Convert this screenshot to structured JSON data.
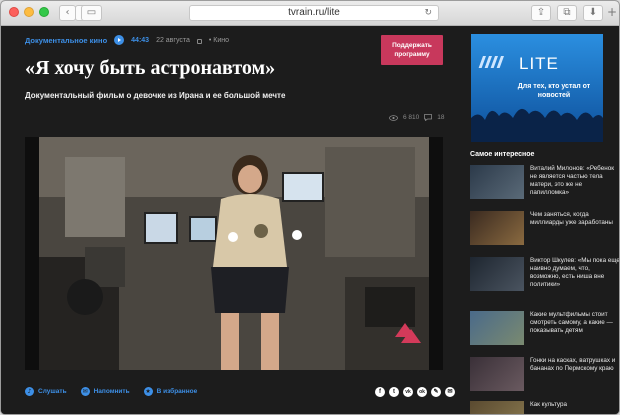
{
  "browser": {
    "url": "tvrain.ru/lite",
    "back_glyph": "‹",
    "forward_glyph": "›",
    "sidebar_glyph": "▭",
    "reload_glyph": "↻",
    "share_glyph": "⇪",
    "tabs_glyph": "⧉",
    "download_glyph": "⬇",
    "newtab_glyph": "+"
  },
  "article": {
    "category": "Документальное кино",
    "duration": "44:43",
    "date": "22 августа",
    "section": "• Кино",
    "title": "«Я хочу быть астронавтом»",
    "subtitle": "Документальный фильм о девочке из Ирана и ее большой мечте",
    "views": "6 810",
    "comments": "18"
  },
  "support_button": "Поддержать программу",
  "actions": [
    {
      "label": "Слушать",
      "icon": "headphones-icon"
    },
    {
      "label": "Напомнить",
      "icon": "mail-icon"
    },
    {
      "label": "В избранное",
      "icon": "star-icon"
    }
  ],
  "share": [
    {
      "glyph": "f",
      "icon": "facebook-icon"
    },
    {
      "glyph": "t",
      "icon": "twitter-icon"
    },
    {
      "glyph": "vk",
      "icon": "vk-icon"
    },
    {
      "glyph": "ok",
      "icon": "odnoklassniki-icon"
    },
    {
      "glyph": "✎",
      "icon": "pen-icon"
    },
    {
      "glyph": "✉",
      "icon": "mail-share-icon"
    }
  ],
  "ad": {
    "brand": "LITE",
    "text": "Для тех, кто устал от новостей"
  },
  "sidebar": {
    "title": "Самое интересное",
    "items": [
      {
        "text": "Виталий Милонов: «Ребенок не является частью тела матери, это же не папилломка»"
      },
      {
        "text": "Чем заняться, когда миллиарды уже заработаны"
      },
      {
        "text": "Виктор Шкулев: «Мы пока еще наивно думаем, что, возможно, есть ниша вне политики»"
      },
      {
        "text": "Какие мультфильмы стоит смотреть самому, а какие — показывать детям"
      },
      {
        "text": "Гонки на касках, ватрушках и бананах по Пермскому краю"
      },
      {
        "text": "Как культура"
      }
    ]
  },
  "colors": {
    "accent": "#3d8fe6",
    "support": "#c8385c",
    "page_bg": "#1c1c1c"
  }
}
